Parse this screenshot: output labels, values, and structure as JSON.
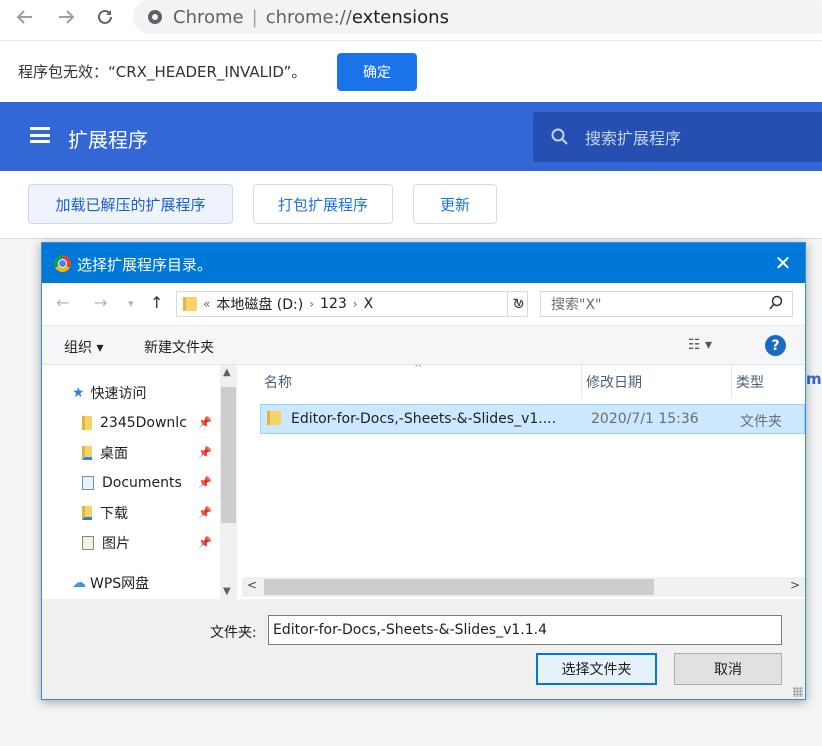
{
  "browser": {
    "site_label": "Chrome",
    "url_scheme": "chrome://",
    "url_host": "extensions"
  },
  "error_bar": {
    "message": "程序包无效：“CRX_HEADER_INVALID”。",
    "ok_label": "确定"
  },
  "extensions": {
    "title": "扩展程序",
    "search_placeholder": "搜索扩展程序",
    "buttons": [
      "加载已解压的扩展程序",
      "打包扩展程序",
      "更新"
    ],
    "right_peek": "m"
  },
  "dialog": {
    "title": "选择扩展程序目录。",
    "path": {
      "chevrons": "«",
      "drive": "本地磁盘 (D:)",
      "folder1": "123",
      "folder2": "X"
    },
    "search_placeholder": "搜索\"X\"",
    "organize": "组织 ▾",
    "new_folder": "新建文件夹",
    "nav": [
      {
        "label": "快速访问",
        "icon": "star-icon"
      },
      {
        "label": "2345Downlc",
        "icon": "folder-icon",
        "pinned": true
      },
      {
        "label": "桌面",
        "icon": "desktop-folder-icon",
        "pinned": true
      },
      {
        "label": "Documents",
        "icon": "documents-icon",
        "pinned": true
      },
      {
        "label": "下载",
        "icon": "download-folder-icon",
        "pinned": true
      },
      {
        "label": "图片",
        "icon": "pictures-folder-icon",
        "pinned": true
      },
      {
        "label": "WPS网盘",
        "icon": "cloud-icon"
      }
    ],
    "columns": {
      "name": "名称",
      "modified": "修改日期",
      "type": "类型"
    },
    "rows": [
      {
        "name": "Editor-for-Docs,-Sheets-&-Slides_v1....",
        "modified": "2020/7/1 15:36",
        "type": "文件夹"
      }
    ],
    "folder_label": "文件夹:",
    "folder_value": "Editor-for-Docs,-Sheets-&-Slides_v1.1.4",
    "select_label": "选择文件夹",
    "cancel_label": "取消"
  }
}
